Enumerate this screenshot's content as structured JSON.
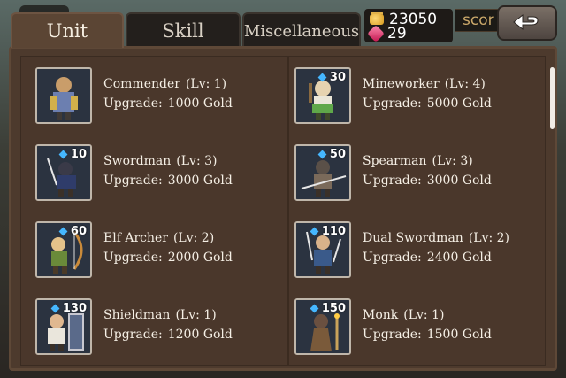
{
  "tabs": [
    {
      "label": "Unit",
      "active": true
    },
    {
      "label": "Skill",
      "active": false
    },
    {
      "label": "Miscellaneous",
      "active": false
    }
  ],
  "resources": {
    "gold": "23050",
    "gems": "29"
  },
  "score_label": "scor",
  "colors": {
    "panel": "#4d3a2d",
    "tab_active": "#5b4534",
    "text": "#f5efe5",
    "gem": "#45b7ff"
  },
  "units": [
    {
      "name": "Commender",
      "level_label": "(Lv: 1)",
      "upgrade_label": "Upgrade:",
      "upgrade_cost": "1000 Gold",
      "cost": "",
      "icon": "commander-icon"
    },
    {
      "name": "Mineworker",
      "level_label": "(Lv: 4)",
      "upgrade_label": "Upgrade:",
      "upgrade_cost": "5000 Gold",
      "cost": "30",
      "icon": "mineworker-icon"
    },
    {
      "name": "Swordman",
      "level_label": "(Lv: 3)",
      "upgrade_label": "Upgrade:",
      "upgrade_cost": "3000 Gold",
      "cost": "10",
      "icon": "swordman-icon"
    },
    {
      "name": "Spearman",
      "level_label": "(Lv: 3)",
      "upgrade_label": "Upgrade:",
      "upgrade_cost": "3000 Gold",
      "cost": "50",
      "icon": "spearman-icon"
    },
    {
      "name": "Elf Archer",
      "level_label": "(Lv: 2)",
      "upgrade_label": "Upgrade:",
      "upgrade_cost": "2000 Gold",
      "cost": "60",
      "icon": "elf-archer-icon"
    },
    {
      "name": "Dual Swordman",
      "level_label": "(Lv: 2)",
      "upgrade_label": "Upgrade:",
      "upgrade_cost": "2400 Gold",
      "cost": "110",
      "icon": "dual-swordman-icon"
    },
    {
      "name": "Shieldman",
      "level_label": "(Lv: 1)",
      "upgrade_label": "Upgrade:",
      "upgrade_cost": "1200 Gold",
      "cost": "130",
      "icon": "shieldman-icon"
    },
    {
      "name": "Monk",
      "level_label": "(Lv: 1)",
      "upgrade_label": "Upgrade:",
      "upgrade_cost": "1500 Gold",
      "cost": "150",
      "icon": "monk-icon"
    }
  ]
}
